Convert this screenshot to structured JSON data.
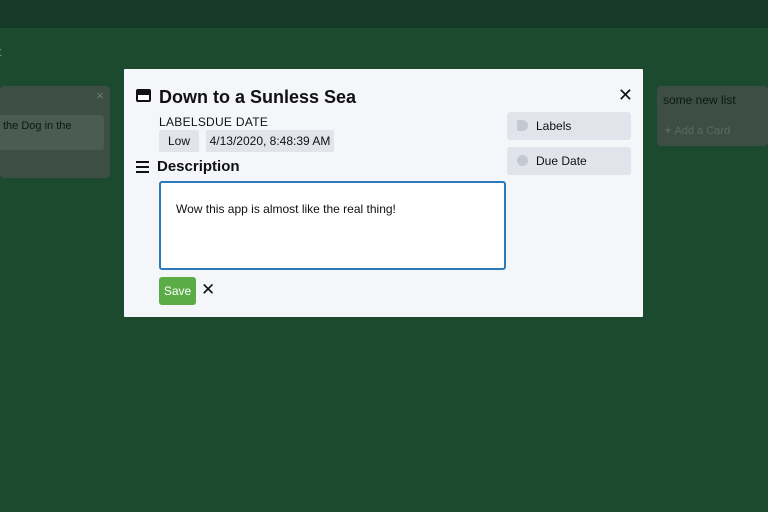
{
  "board": {
    "title_fragment": "t",
    "lists": [
      {
        "close_glyph": "×",
        "card_text": "the Dog in the"
      },
      {
        "title": "some new list",
        "add_card": "Add a Card",
        "add_glyph": "+"
      }
    ]
  },
  "modal": {
    "title": "Down to a Sunless Sea",
    "close_glyph": "✕",
    "labels_heading": "LABELS",
    "due_heading": "DUE DATE",
    "label_value": "Low",
    "due_value": "4/13/2020, 8:48:39 AM",
    "description_heading": "Description",
    "description_text": "Wow this app is almost like the real thing!",
    "save_label": "Save",
    "cancel_glyph": "✕",
    "sidebar": {
      "labels_button": "Labels",
      "due_date_button": "Due Date"
    }
  },
  "colors": {
    "background": "#1b4a2f",
    "modal": "#f4f6f9",
    "save": "#5aac44",
    "focus_border": "#2e7ab8"
  },
  "icons": {
    "card": "card-icon",
    "description": "list-lines-icon",
    "labels": "tag-icon",
    "due_date": "clock-icon"
  }
}
